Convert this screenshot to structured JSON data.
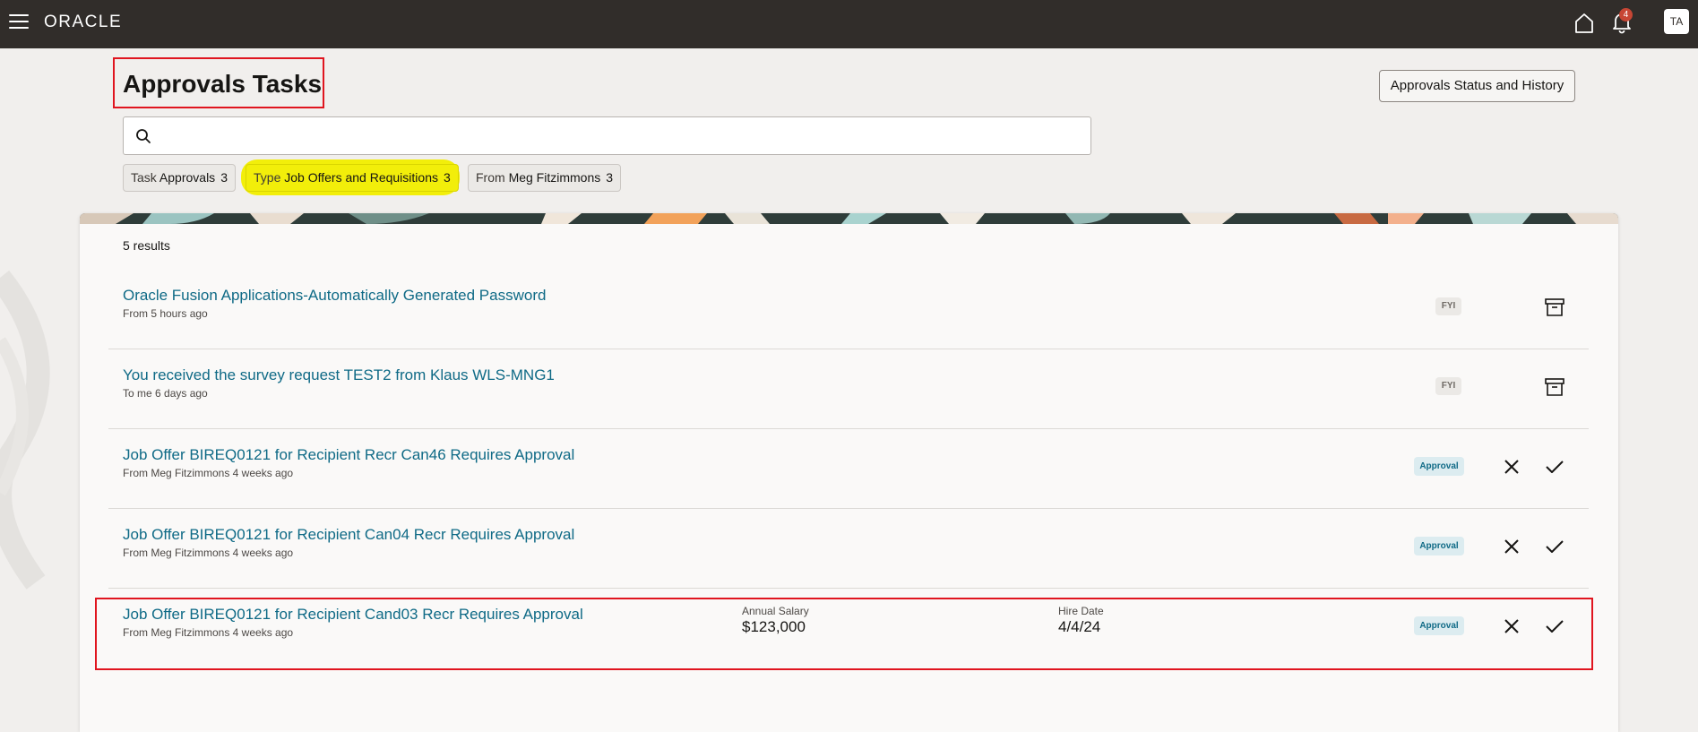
{
  "app": {
    "logo": "ORACLE",
    "notification_count": "4",
    "avatar_initials": "TA"
  },
  "page": {
    "title": "Approvals Tasks",
    "history_button": "Approvals Status and History",
    "search_placeholder": ""
  },
  "filters": [
    {
      "key": "Task",
      "value": "Approvals",
      "count": "3",
      "highlighted": false
    },
    {
      "key": "Type",
      "value": "Job Offers and Requisitions",
      "count": "3",
      "highlighted": true
    },
    {
      "key": "From",
      "value": "Meg Fitzimmons",
      "count": "3",
      "highlighted": false
    }
  ],
  "results": {
    "count_label": "5 results",
    "items": [
      {
        "title": "Oracle Fusion Applications-Automatically Generated Password",
        "subtitle": "From 5 hours ago",
        "badge": "FYI",
        "actions": "archive"
      },
      {
        "title": "You received the survey request TEST2 from Klaus WLS-MNG1",
        "subtitle": "To me 6 days ago",
        "badge": "FYI",
        "actions": "archive"
      },
      {
        "title": "Job Offer BIREQ0121 for Recipient Recr Can46 Requires Approval",
        "subtitle": "From Meg Fitzimmons 4 weeks ago",
        "badge": "Approval",
        "actions": "approve-reject"
      },
      {
        "title": "Job Offer BIREQ0121 for Recipient Can04 Recr Requires Approval",
        "subtitle": "From Meg Fitzimmons 4 weeks ago",
        "badge": "Approval",
        "actions": "approve-reject"
      },
      {
        "title": "Job Offer BIREQ0121 for Recipient Cand03 Recr Requires Approval",
        "subtitle": "From Meg Fitzimmons 4 weeks ago",
        "badge": "Approval",
        "actions": "approve-reject",
        "salary_label": "Annual Salary",
        "salary_value": "$123,000",
        "hire_label": "Hire Date",
        "hire_value": "4/4/24"
      }
    ]
  },
  "colors": {
    "topbar": "#312d2a",
    "link": "#0f6a86",
    "highlight": "#f2ee0a",
    "annotation_red": "#e0151f"
  }
}
